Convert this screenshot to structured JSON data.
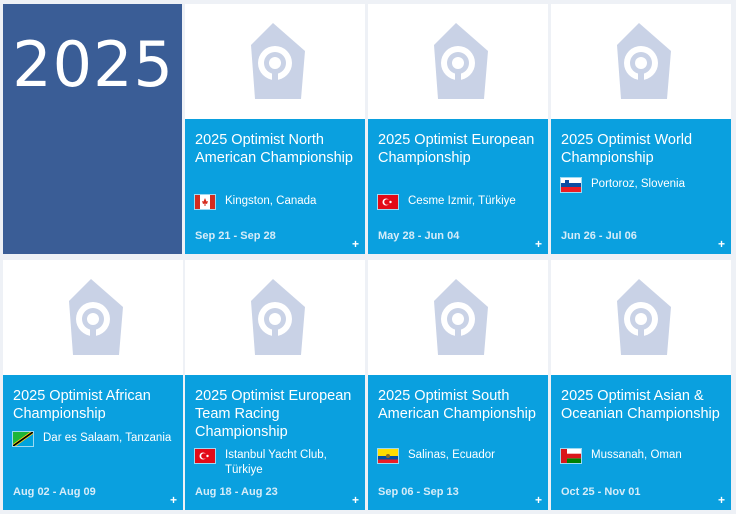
{
  "year": "2025",
  "events": [
    {
      "title": "2025 Optimist North American Championship",
      "location": "Kingston, Canada",
      "dates": "Sep 21 - Sep 28",
      "flag": "canada-flag"
    },
    {
      "title": "2025 Optimist European Championship",
      "location": "Cesme Izmir, Türkiye",
      "dates": "May 28 - Jun 04",
      "flag": "turkiye-flag"
    },
    {
      "title": "2025 Optimist World Championship",
      "location": "Portoroz, Slovenia",
      "dates": "Jun 26 - Jul 06",
      "flag": "slovenia-flag"
    },
    {
      "title": "2025 Optimist African Championship",
      "location": "Dar es Salaam, Tanzania",
      "dates": "Aug 02 - Aug 09",
      "flag": "tanzania-flag"
    },
    {
      "title": "2025 Optimist European Team Racing Championship",
      "location": "Istanbul Yacht Club, Türkiye",
      "dates": "Aug 18 - Aug 23",
      "flag": "turkiye-flag"
    },
    {
      "title": "2025 Optimist South American Championship",
      "location": "Salinas, Ecuador",
      "dates": "Sep 06 - Sep 13",
      "flag": "ecuador-flag"
    },
    {
      "title": "2025 Optimist Asian & Oceanian Championship",
      "location": "Mussanah, Oman",
      "dates": "Oct 25 - Nov 01",
      "flag": "oman-flag"
    }
  ],
  "expand_label": "+",
  "colors": {
    "year_tile": "#3a5d96",
    "card_body": "#0aa0df",
    "logo": "#c9d2e6"
  }
}
